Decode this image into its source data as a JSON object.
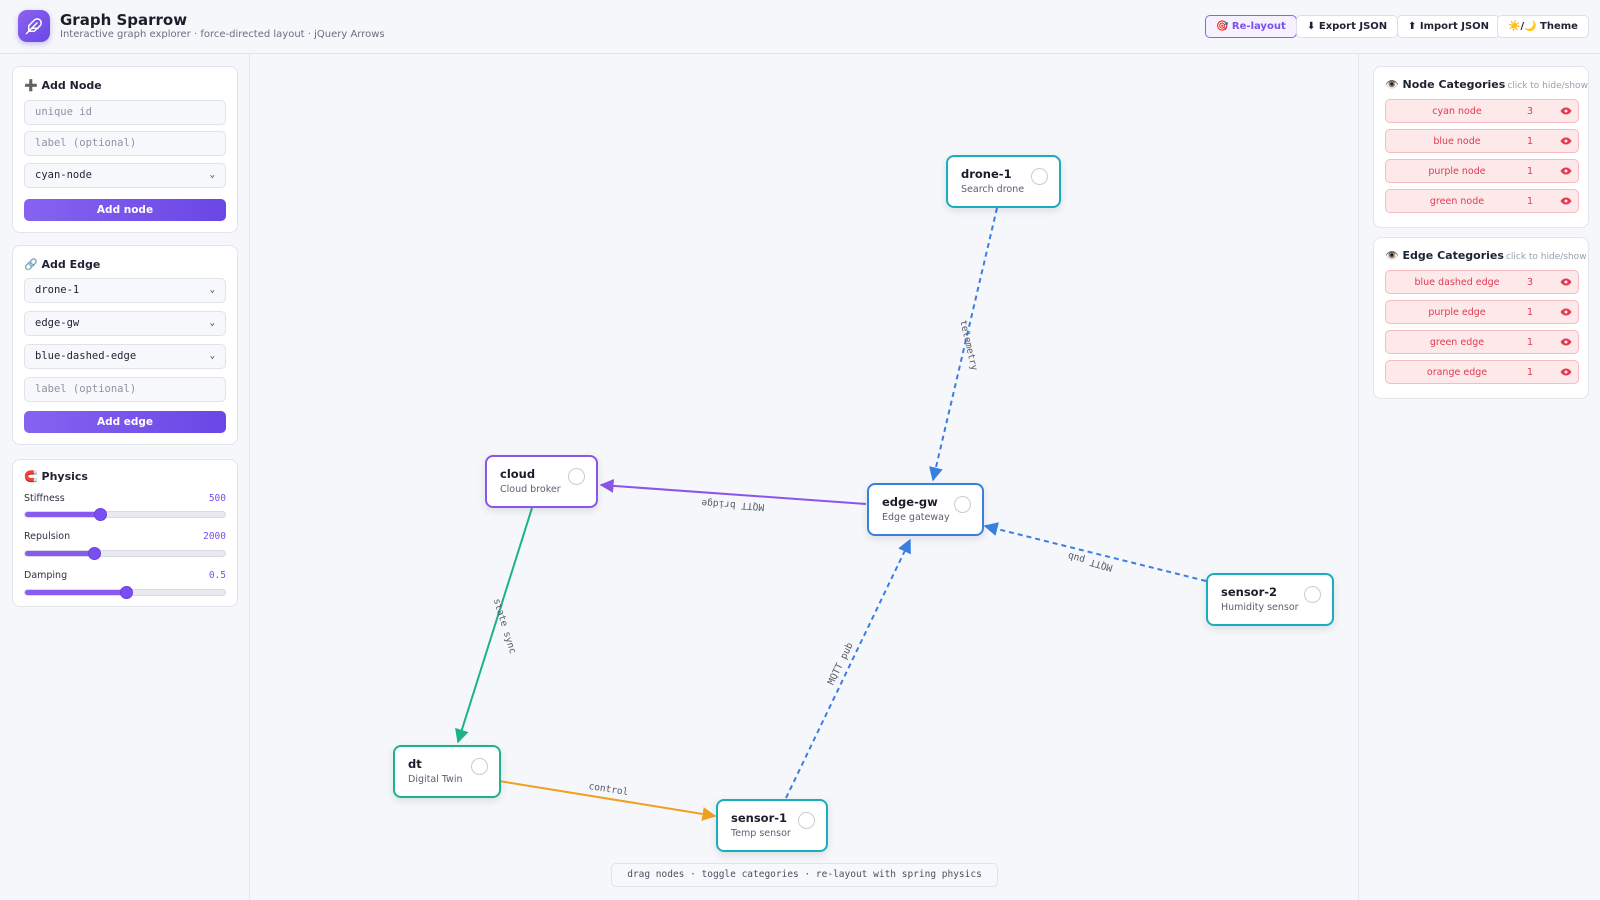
{
  "header": {
    "logo_icon": "feather-icon",
    "title": "Graph Sparrow",
    "subtitle": "Interactive graph explorer · force-directed layout · jQuery Arrows",
    "buttons": {
      "relayout": "🎯 Re-layout",
      "export": "⬇ Export JSON",
      "import": "⬆ Import JSON",
      "theme": "☀️/🌙 Theme"
    }
  },
  "add_node": {
    "title": "➕ Add Node",
    "id_placeholder": "unique id",
    "label_placeholder": "label (optional)",
    "type_value": "cyan-node",
    "button": "Add node"
  },
  "add_edge": {
    "title": "🔗 Add Edge",
    "from_value": "drone-1",
    "to_value": "edge-gw",
    "type_value": "blue-dashed-edge",
    "label_placeholder": "label (optional)",
    "button": "Add edge"
  },
  "physics": {
    "title": "🧲 Physics",
    "sliders": [
      {
        "label": "Stiffness",
        "value": "500",
        "fraction": 0.375
      },
      {
        "label": "Repulsion",
        "value": "2000",
        "fraction": 0.345
      },
      {
        "label": "Damping",
        "value": "0.5",
        "fraction": 0.505
      }
    ]
  },
  "node_categories": {
    "title": "👁️ Node Categories",
    "hint": "click to hide/show",
    "items": [
      {
        "name": "cyan node",
        "count": "3"
      },
      {
        "name": "blue node",
        "count": "1"
      },
      {
        "name": "purple node",
        "count": "1"
      },
      {
        "name": "green node",
        "count": "1"
      }
    ]
  },
  "edge_categories": {
    "title": "👁️ Edge Categories",
    "hint": "click to hide/show",
    "items": [
      {
        "name": "blue dashed edge",
        "count": "3"
      },
      {
        "name": "purple edge",
        "count": "1"
      },
      {
        "name": "green edge",
        "count": "1"
      },
      {
        "name": "orange edge",
        "count": "1"
      }
    ]
  },
  "graph": {
    "nodes": [
      {
        "id": "drone-1",
        "label": "Search drone",
        "type": "cyan"
      },
      {
        "id": "cloud",
        "label": "Cloud broker",
        "type": "purple"
      },
      {
        "id": "edge-gw",
        "label": "Edge gateway",
        "type": "blue"
      },
      {
        "id": "sensor-2",
        "label": "Humidity sensor",
        "type": "cyan"
      },
      {
        "id": "dt",
        "label": "Digital Twin",
        "type": "green"
      },
      {
        "id": "sensor-1",
        "label": "Temp sensor",
        "type": "cyan"
      }
    ],
    "edges": [
      {
        "from": "drone-1",
        "to": "edge-gw",
        "label": "telemetry",
        "type": "blue-dashed"
      },
      {
        "from": "edge-gw",
        "to": "cloud",
        "label": "MQTT bridge",
        "type": "purple"
      },
      {
        "from": "sensor-2",
        "to": "edge-gw",
        "label": "MQTT pub",
        "type": "blue-dashed"
      },
      {
        "from": "cloud",
        "to": "dt",
        "label": "state sync",
        "type": "green"
      },
      {
        "from": "sensor-1",
        "to": "edge-gw",
        "label": "MQTT pub",
        "type": "blue-dashed"
      },
      {
        "from": "dt",
        "to": "sensor-1",
        "label": "control",
        "type": "orange"
      }
    ]
  },
  "footer_hint": "drag nodes · toggle categories · re-layout with spring physics",
  "colors": {
    "accent": "#7a4ff0",
    "cyan": "#17aebf",
    "blue": "#3a7fe0",
    "purple": "#8a56e8",
    "green": "#1ab38a",
    "orange": "#f0a020",
    "category_text": "#e23a4f"
  }
}
